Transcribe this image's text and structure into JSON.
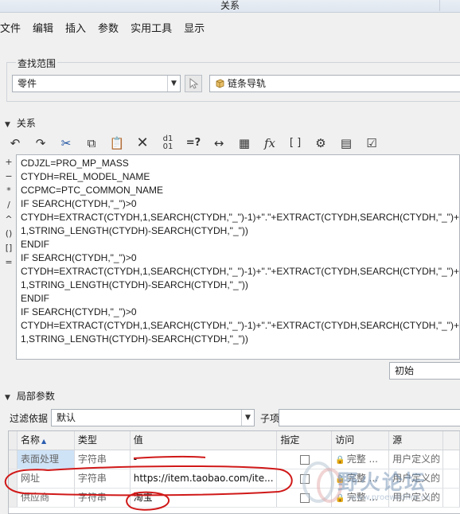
{
  "window": {
    "title": "关系"
  },
  "menu": [
    "文件",
    "编辑",
    "插入",
    "参数",
    "实用工具",
    "显示"
  ],
  "search_scope": {
    "label": "查找范围",
    "type_value": "零件",
    "model_value": "链条导轨"
  },
  "relations": {
    "label": "关系",
    "side_ops": [
      "+",
      "−",
      "*",
      "/",
      "^",
      "()",
      "[]",
      "="
    ],
    "toolbar_icons": [
      "undo-icon",
      "redo-icon",
      "cut-icon",
      "copy-icon",
      "paste-icon",
      "delete-icon",
      "switch-units-icon",
      "evaluate-icon",
      "measure-icon",
      "show-values-icon",
      "function-icon",
      "brackets-icon",
      "sort-icon",
      "execute-icon",
      "verify-icon"
    ],
    "text": "CDJZL=PRO_MP_MASS\nCTYDH=REL_MODEL_NAME\nCCPMC=PTC_COMMON_NAME\nIF SEARCH(CTYDH,\"_\")>0\nCTYDH=EXTRACT(CTYDH,1,SEARCH(CTYDH,\"_\")-1)+\".\"+EXTRACT(CTYDH,SEARCH(CTYDH,\"_\")+\\\n1,STRING_LENGTH(CTYDH)-SEARCH(CTYDH,\"_\"))\nENDIF\nIF SEARCH(CTYDH,\"_\")>0\nCTYDH=EXTRACT(CTYDH,1,SEARCH(CTYDH,\"_\")-1)+\".\"+EXTRACT(CTYDH,SEARCH(CTYDH,\"_\")+\\\n1,STRING_LENGTH(CTYDH)-SEARCH(CTYDH,\"_\"))\nENDIF\nIF SEARCH(CTYDH,\"_\")>0\nCTYDH=EXTRACT(CTYDH,1,SEARCH(CTYDH,\"_\")-1)+\".\"+EXTRACT(CTYDH,SEARCH(CTYDH,\"_\")+\\\n1,STRING_LENGTH(CTYDH)-SEARCH(CTYDH,\"_\"))",
    "init_value": "初始"
  },
  "local_params": {
    "label": "局部参数",
    "filter_label": "过滤依据",
    "filter_value": "默认",
    "subitem_label": "子项",
    "columns": [
      "名称",
      "类型",
      "值",
      "指定",
      "访问",
      "源"
    ],
    "rows": [
      {
        "name": "表面处理",
        "type": "字符串",
        "value": "-",
        "access": "完整 ...",
        "source": "用户定义的"
      },
      {
        "name": "网址",
        "type": "字符串",
        "value": "https://item.taobao.com/ite...",
        "access": "完整 ...",
        "source": "用户定义的"
      },
      {
        "name": "供应商",
        "type": "字符串",
        "value": "淘宝",
        "access": "完整 ...",
        "source": "用户定义的"
      }
    ]
  },
  "watermark": {
    "text": "野火论坛",
    "sub": "www.proewildfire.cn"
  },
  "colors": {
    "annotation_red": "#d01818",
    "selected_cell": "#cfe3f7"
  }
}
